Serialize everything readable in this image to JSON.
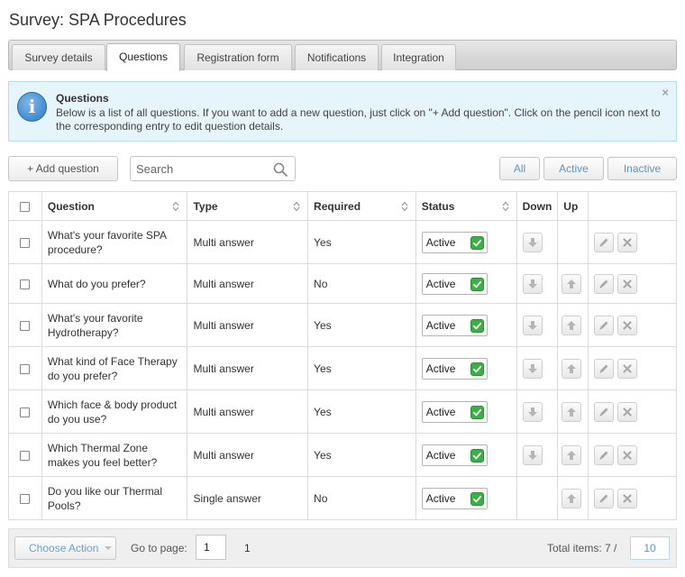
{
  "page": {
    "title": "Survey: SPA Procedures"
  },
  "tabs": [
    {
      "label": "Survey details"
    },
    {
      "label": "Questions"
    },
    {
      "label": "Registration form"
    },
    {
      "label": "Notifications"
    },
    {
      "label": "Integration"
    }
  ],
  "active_tab": "Questions",
  "info": {
    "title": "Questions",
    "text": "Below is a list of all questions. If you want to add a new question, just click on \"+ Add question\". Click on the pencil icon next to the corresponding entry to edit question details.",
    "close": "×"
  },
  "toolbar": {
    "add_label": "+ Add question",
    "search_placeholder": "Search",
    "filter_all": "All",
    "filter_active": "Active",
    "filter_inactive": "Inactive"
  },
  "table": {
    "headers": {
      "question": "Question",
      "type": "Type",
      "required": "Required",
      "status": "Status",
      "down": "Down",
      "up": "Up"
    },
    "rows": [
      {
        "question": "What's your favorite SPA procedure?",
        "type": "Multi answer",
        "required": "Yes",
        "status": "Active",
        "can_down": true,
        "can_up": false
      },
      {
        "question": "What do you prefer?",
        "type": "Multi answer",
        "required": "No",
        "status": "Active",
        "can_down": true,
        "can_up": true
      },
      {
        "question": "What's your favorite Hydrotherapy?",
        "type": "Multi answer",
        "required": "Yes",
        "status": "Active",
        "can_down": true,
        "can_up": true
      },
      {
        "question": "What kind of Face Therapy do you prefer?",
        "type": "Multi answer",
        "required": "Yes",
        "status": "Active",
        "can_down": true,
        "can_up": true
      },
      {
        "question": "Which face & body product do you use?",
        "type": "Multi answer",
        "required": "Yes",
        "status": "Active",
        "can_down": true,
        "can_up": true
      },
      {
        "question": "Which Thermal Zone makes you feel better?",
        "type": "Multi answer",
        "required": "Yes",
        "status": "Active",
        "can_down": true,
        "can_up": true
      },
      {
        "question": "Do you like our Thermal Pools?",
        "type": "Single answer",
        "required": "No",
        "status": "Active",
        "can_down": false,
        "can_up": true
      }
    ]
  },
  "footer": {
    "choose_action": "Choose Action",
    "goto_label": "Go to page:",
    "goto_value": "1",
    "page_number": "1",
    "total_label": "Total items: 7 /",
    "per_page": "10"
  },
  "colors": {
    "accent": "#5a97c8",
    "status_check": "#3fae49",
    "info_bg": "#e6f4fb"
  },
  "icons": [
    "info-icon",
    "close-icon",
    "search-icon",
    "sort-icon",
    "check-icon",
    "arrow-down-icon",
    "arrow-up-icon",
    "pencil-icon",
    "delete-icon",
    "chevron-down-icon"
  ]
}
